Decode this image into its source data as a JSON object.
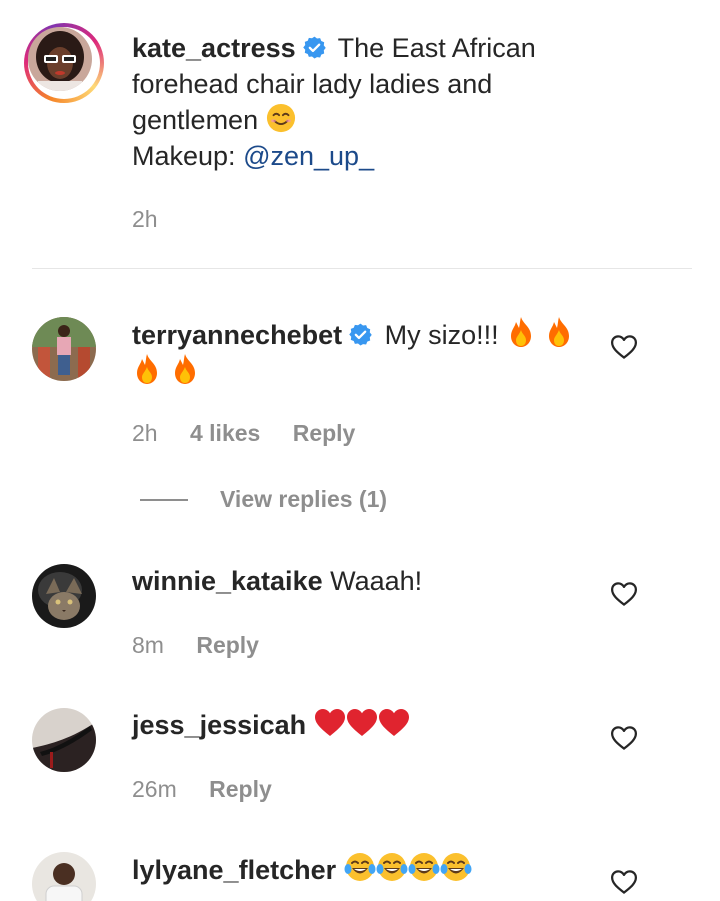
{
  "caption": {
    "username": "kate_actress",
    "text_line1": "The East African",
    "text_line2": "forehead chair lady ladies and",
    "text_line3": "gentlemen",
    "makeup_label": "Makeup:",
    "mention": "@zen_up_",
    "time": "2h"
  },
  "comments": [
    {
      "username": "terryannechebet",
      "text": "My sizo!!!",
      "time": "2h",
      "likes": "4 likes",
      "reply": "Reply",
      "view_replies": "View replies (1)"
    },
    {
      "username": "winnie_kataike",
      "text": "Waaah!",
      "time": "8m",
      "reply": "Reply"
    },
    {
      "username": "jess_jessicah",
      "text": "",
      "time": "26m",
      "reply": "Reply"
    },
    {
      "username": "lylyane_fletcher",
      "text": ""
    }
  ],
  "icons": {
    "verified": "verified-badge-icon",
    "like": "heart-outline-icon",
    "fire": "fire-emoji",
    "heart": "red-heart-emoji",
    "laugh": "tears-of-joy-emoji",
    "smile": "smiling-face-emoji"
  },
  "colors": {
    "text": "#262626",
    "secondary": "#8e8e8e",
    "mention": "#1c4a8a",
    "verified": "#3897f0",
    "divider": "#e6e6e6"
  }
}
